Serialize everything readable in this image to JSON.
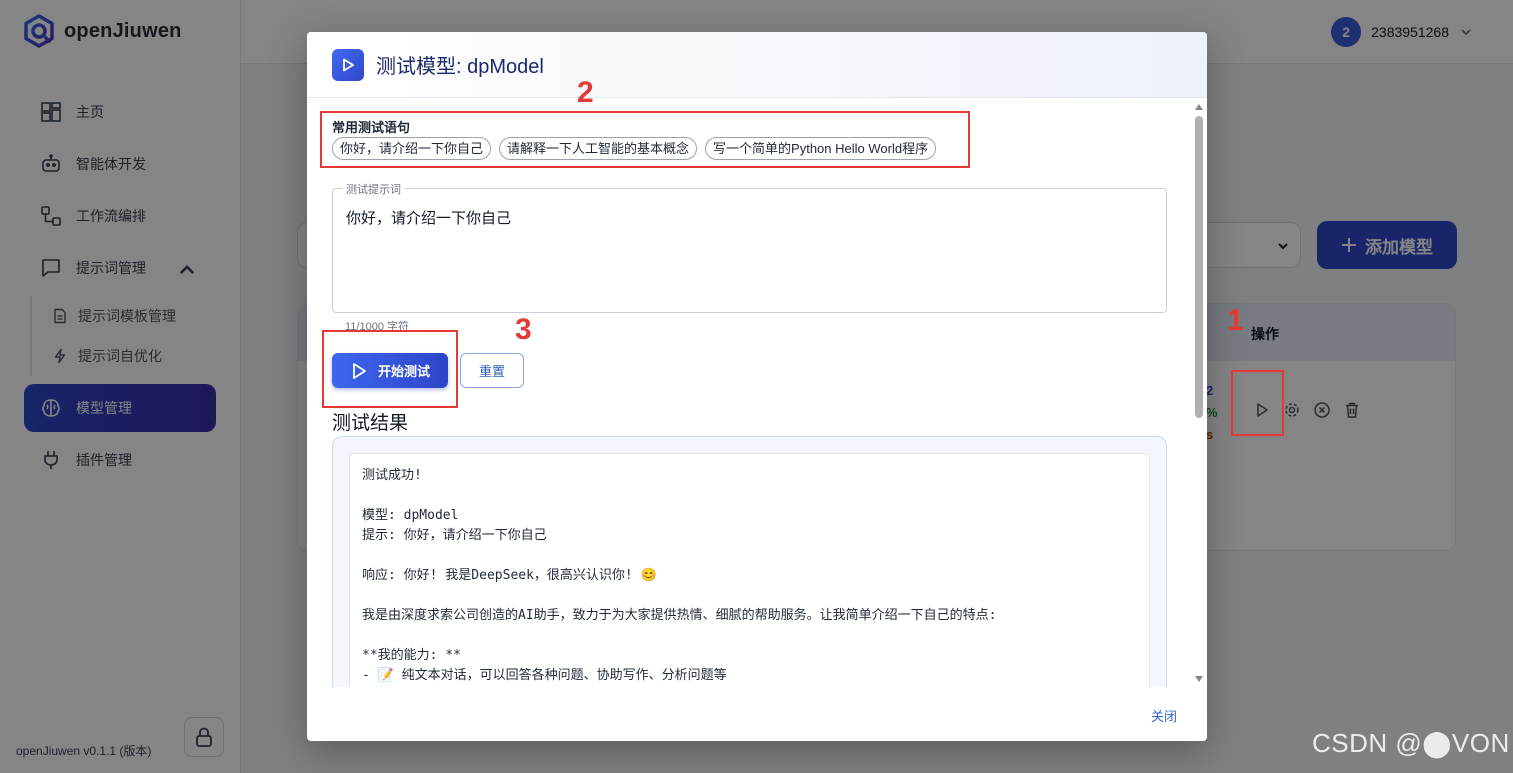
{
  "app": {
    "name": "openJiuwen",
    "version": "openJiuwen v0.1.1 (版本)"
  },
  "sidebar": {
    "items": [
      {
        "label": "主页",
        "icon": "dashboard-icon"
      },
      {
        "label": "智能体开发",
        "icon": "robot-icon"
      },
      {
        "label": "工作流编排",
        "icon": "workflow-icon"
      },
      {
        "label": "提示词管理",
        "icon": "chat-icon"
      },
      {
        "label": "模型管理",
        "icon": "brain-icon"
      },
      {
        "label": "插件管理",
        "icon": "plug-icon"
      }
    ],
    "sub_items": [
      {
        "label": "提示词模板管理",
        "icon": "document-icon"
      },
      {
        "label": "提示词自优化",
        "icon": "lightning-icon"
      }
    ],
    "active": "模型管理"
  },
  "topbar": {
    "user_avatar": "2",
    "user_name": "2383951268"
  },
  "main": {
    "add_button": "添加模型",
    "table_header_ops": "操作",
    "row_stats": [
      "2",
      "%",
      "s"
    ]
  },
  "modal": {
    "title": "测试模型: dpModel",
    "quick_label": "常用测试语句",
    "quick_prompts": [
      "你好，请介绍一下你自己",
      "请解释一下人工智能的基本概念",
      "写一个简单的Python Hello World程序"
    ],
    "prompt_legend": "测试提示词",
    "prompt_value": "你好，请介绍一下你自己",
    "char_count": "11/1000 字符",
    "start_button": "开始测试",
    "reset_button": "重置",
    "result_title": "测试结果",
    "result_lines": [
      "测试成功!",
      "",
      "模型: dpModel",
      "提示: 你好，请介绍一下你自己",
      "",
      "响应: 你好! 我是DeepSeek，很高兴认识你! 😊",
      "",
      "我是由深度求索公司创造的AI助手，致力于为大家提供热情、细腻的帮助服务。让我简单介绍一下自己的特点:",
      "",
      "**我的能力: **",
      "- 📝 纯文本对话，可以回答各种问题、协助写作、分析问题等"
    ],
    "close_button": "关闭"
  },
  "annotations": [
    "1",
    "2",
    "3"
  ],
  "watermark": "CSDN @⬤VON",
  "colors": {
    "accent": "#2e47c9",
    "annotation": "#e53935",
    "overlay": "rgba(0,0,0,0.48)"
  }
}
